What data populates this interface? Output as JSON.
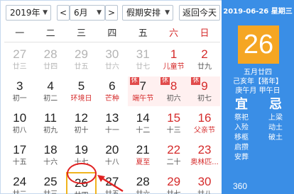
{
  "toolbar": {
    "year": "2019年",
    "month": "6月",
    "holiday": "假期安排",
    "today_button": "返回今天",
    "prev": "<",
    "next": ">"
  },
  "weekdays": [
    "一",
    "二",
    "三",
    "四",
    "五",
    "六",
    "日"
  ],
  "weeks": [
    [
      {
        "n": "27",
        "l": "廿三",
        "o": true
      },
      {
        "n": "28",
        "l": "廿四",
        "o": true
      },
      {
        "n": "29",
        "l": "廿五",
        "o": true
      },
      {
        "n": "30",
        "l": "廿六",
        "o": true
      },
      {
        "n": "31",
        "l": "廿七",
        "o": true
      },
      {
        "n": "1",
        "l": "儿童节",
        "we": true,
        "f": true
      },
      {
        "n": "2",
        "l": "廿九",
        "we": true
      }
    ],
    [
      {
        "n": "3",
        "l": "初一"
      },
      {
        "n": "4",
        "l": "初二"
      },
      {
        "n": "5",
        "l": "环境日",
        "f": true
      },
      {
        "n": "6",
        "l": "芒种",
        "f": true
      },
      {
        "n": "7",
        "l": "端午节",
        "f": true,
        "h": true,
        "tag": "休"
      },
      {
        "n": "8",
        "l": "初六",
        "we": true,
        "h": true,
        "tag": "休"
      },
      {
        "n": "9",
        "l": "初七",
        "we": true,
        "h": true,
        "tag": "休"
      }
    ],
    [
      {
        "n": "10",
        "l": "初八"
      },
      {
        "n": "11",
        "l": "初九"
      },
      {
        "n": "12",
        "l": "初十"
      },
      {
        "n": "13",
        "l": "十一"
      },
      {
        "n": "14",
        "l": "十二"
      },
      {
        "n": "15",
        "l": "十三",
        "we": true
      },
      {
        "n": "16",
        "l": "父亲节",
        "we": true,
        "f": true
      }
    ],
    [
      {
        "n": "17",
        "l": "十五"
      },
      {
        "n": "18",
        "l": "十六"
      },
      {
        "n": "19",
        "l": "十七"
      },
      {
        "n": "20",
        "l": "十八"
      },
      {
        "n": "21",
        "l": "夏至",
        "f": true
      },
      {
        "n": "22",
        "l": "二十",
        "we": true
      },
      {
        "n": "23",
        "l": "奥林匹...",
        "we": true,
        "f": true
      }
    ],
    [
      {
        "n": "24",
        "l": "廿二"
      },
      {
        "n": "25",
        "l": "廿三"
      },
      {
        "n": "26",
        "l": "廿四",
        "t": true
      },
      {
        "n": "27",
        "l": "廿五"
      },
      {
        "n": "28",
        "l": "廿六"
      },
      {
        "n": "29",
        "l": "廿七",
        "we": true
      },
      {
        "n": "30",
        "l": "廿八",
        "we": true
      }
    ]
  ],
  "panel": {
    "date_line": "2019-06-26 星期三",
    "big_day": "26",
    "lunar_date": "五月廿四",
    "ganzhi_year": "己亥年【猪年】",
    "ganzhi_month_day": "庚午月 甲午日",
    "yi_label": "宜",
    "ji_label": "忌",
    "yi_items": [
      "祭祀",
      "入殓",
      "移柩",
      "启攒",
      "安葬"
    ],
    "ji_items": [
      "上梁",
      "动土",
      "破土"
    ],
    "logo": "360"
  },
  "colors": {
    "panel_blue": "#3a8ee6",
    "accent_orange": "#f5a623",
    "holiday_red": "#d52b2b"
  }
}
